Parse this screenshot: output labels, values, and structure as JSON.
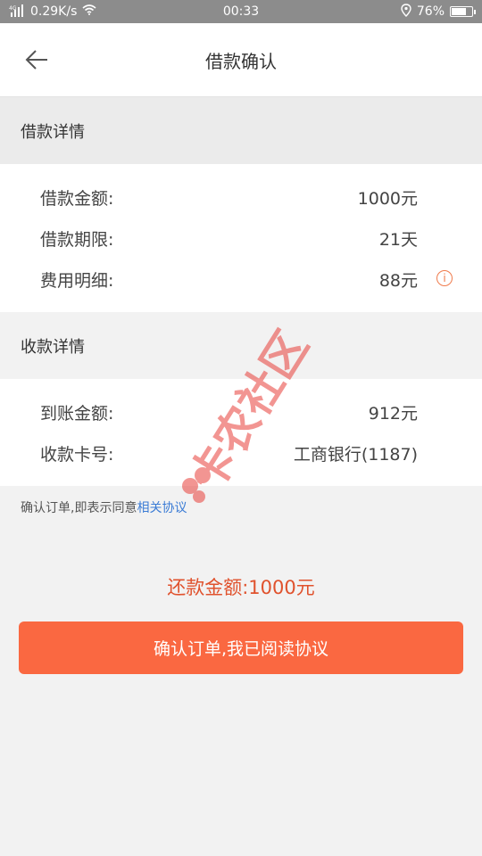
{
  "status_bar": {
    "network": "4G",
    "speed": "0.29K/s",
    "time": "00:33",
    "battery": "76%",
    "battery_level": 0.76
  },
  "header": {
    "title": "借款确认"
  },
  "loan_details": {
    "section_title": "借款详情",
    "rows": [
      {
        "label": "借款金额:",
        "value": "1000元"
      },
      {
        "label": "借款期限:",
        "value": "21天"
      },
      {
        "label": "费用明细:",
        "value": "88元"
      }
    ]
  },
  "receive_details": {
    "section_title": "收款详情",
    "rows": [
      {
        "label": "到账金额:",
        "value": "912元"
      },
      {
        "label": "收款卡号:",
        "value": "工商银行(1187)"
      }
    ]
  },
  "agreement": {
    "text": "确认订单,即表示同意",
    "link": "相关协议"
  },
  "repay": {
    "text": "还款金额:1000元"
  },
  "confirm_button": {
    "label": "确认订单,我已阅读协议"
  },
  "watermark": {
    "text": "卡农社区"
  },
  "colors": {
    "accent": "#fa6841",
    "repay_text": "#e0522d",
    "link": "#3a7bd5",
    "watermark": "#e8403a"
  }
}
